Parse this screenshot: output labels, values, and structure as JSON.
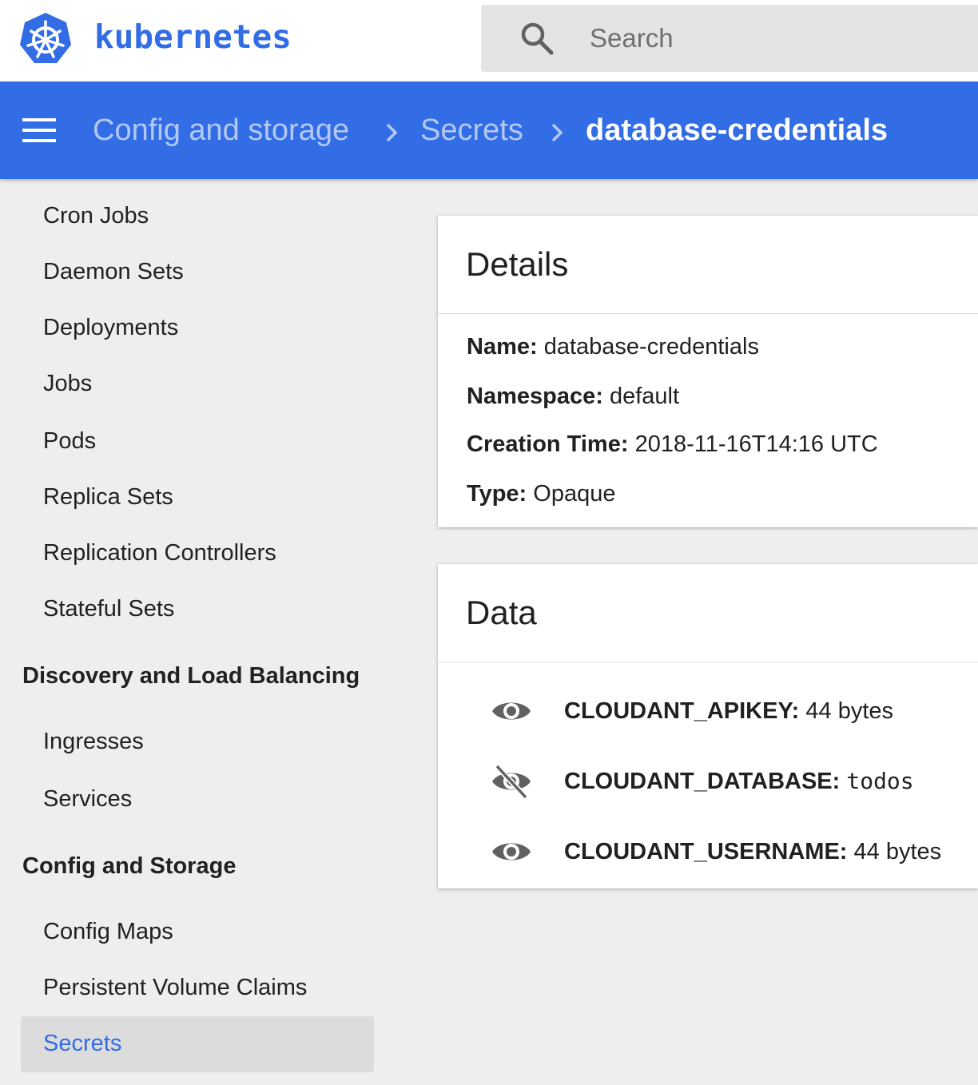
{
  "app": {
    "brand": "kubernetes",
    "brand_color": "#326de6"
  },
  "search": {
    "placeholder": "Search",
    "value": ""
  },
  "breadcrumb": {
    "items": [
      "Config and storage",
      "Secrets"
    ],
    "current": "database-credentials"
  },
  "sidebar": {
    "workload_items": [
      "Cron Jobs",
      "Daemon Sets",
      "Deployments",
      "Jobs",
      "Pods",
      "Replica Sets",
      "Replication Controllers",
      "Stateful Sets"
    ],
    "discovery_section": "Discovery and Load Balancing",
    "discovery_items": [
      "Ingresses",
      "Services"
    ],
    "config_section": "Config and Storage",
    "config_items": [
      "Config Maps",
      "Persistent Volume Claims"
    ],
    "active_item": "Secrets"
  },
  "details": {
    "title": "Details",
    "rows": [
      {
        "key": "Name:",
        "value": "database-credentials"
      },
      {
        "key": "Namespace:",
        "value": "default"
      },
      {
        "key": "Creation Time:",
        "value": "2018-11-16T14:16 UTC"
      },
      {
        "key": "Type:",
        "value": "Opaque"
      }
    ]
  },
  "data": {
    "title": "Data",
    "rows": [
      {
        "key": "CLOUDANT_APIKEY:",
        "value": "44 bytes",
        "icon": "eye-icon",
        "revealed": false
      },
      {
        "key": "CLOUDANT_DATABASE:",
        "value": "todos",
        "icon": "eye-off-icon",
        "revealed": true
      },
      {
        "key": "CLOUDANT_USERNAME:",
        "value": "44 bytes",
        "icon": "eye-icon",
        "revealed": false
      }
    ]
  }
}
